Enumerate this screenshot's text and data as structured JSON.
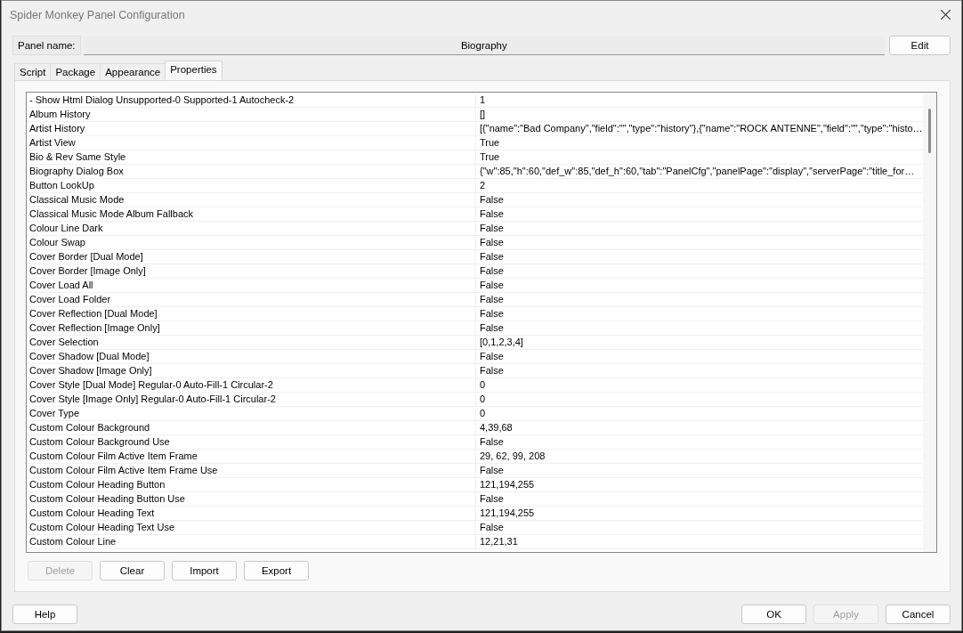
{
  "window": {
    "title": "Spider Monkey Panel Configuration"
  },
  "panel_name": {
    "label": "Panel name:",
    "value": "Biography",
    "button": "Edit"
  },
  "tabs": [
    {
      "label": "Script",
      "selected": false
    },
    {
      "label": "Package",
      "selected": false
    },
    {
      "label": "Appearance",
      "selected": false
    },
    {
      "label": "Properties",
      "selected": true
    }
  ],
  "properties": [
    {
      "name": "- Show Html Dialog Unsupported-0 Supported-1 Autocheck-2",
      "value": "1"
    },
    {
      "name": "Album History",
      "value": "[]"
    },
    {
      "name": "Artist History",
      "value": "[{\"name\":\"Bad Company\",\"field\":\"\",\"type\":\"history\"},{\"name\":\"ROCK ANTENNE\",\"field\":\"\",\"type\":\"histo…"
    },
    {
      "name": "Artist View",
      "value": "True"
    },
    {
      "name": "Bio & Rev Same Style",
      "value": "True"
    },
    {
      "name": "Biography Dialog Box",
      "value": "{\"w\":85,\"h\":60,\"def_w\":85,\"def_h\":60,\"tab\":\"PanelCfg\",\"panelPage\":\"display\",\"serverPage\":\"title_for…"
    },
    {
      "name": "Button LookUp",
      "value": "2"
    },
    {
      "name": "Classical Music Mode",
      "value": "False"
    },
    {
      "name": "Classical Music Mode Album Fallback",
      "value": "False"
    },
    {
      "name": "Colour Line Dark",
      "value": "False"
    },
    {
      "name": "Colour Swap",
      "value": "False"
    },
    {
      "name": "Cover Border [Dual Mode]",
      "value": "False"
    },
    {
      "name": "Cover Border [Image Only]",
      "value": "False"
    },
    {
      "name": "Cover Load All",
      "value": "False"
    },
    {
      "name": "Cover Load Folder",
      "value": "False"
    },
    {
      "name": "Cover Reflection [Dual Mode]",
      "value": "False"
    },
    {
      "name": "Cover Reflection [Image Only]",
      "value": "False"
    },
    {
      "name": "Cover Selection",
      "value": "[0,1,2,3,4]"
    },
    {
      "name": "Cover Shadow [Dual Mode]",
      "value": "False"
    },
    {
      "name": "Cover Shadow [Image Only]",
      "value": "False"
    },
    {
      "name": "Cover Style [Dual Mode] Regular-0 Auto-Fill-1 Circular-2",
      "value": "0"
    },
    {
      "name": "Cover Style [Image Only] Regular-0 Auto-Fill-1 Circular-2",
      "value": "0"
    },
    {
      "name": "Cover Type",
      "value": "0"
    },
    {
      "name": "Custom Colour Background",
      "value": "4,39,68"
    },
    {
      "name": "Custom Colour Background Use",
      "value": "False"
    },
    {
      "name": "Custom Colour Film Active Item Frame",
      "value": "29, 62, 99, 208"
    },
    {
      "name": "Custom Colour Film Active Item Frame Use",
      "value": "False"
    },
    {
      "name": "Custom Colour Heading Button",
      "value": "121,194,255"
    },
    {
      "name": "Custom Colour Heading Button Use",
      "value": "False"
    },
    {
      "name": "Custom Colour Heading Text",
      "value": "121,194,255"
    },
    {
      "name": "Custom Colour Heading Text Use",
      "value": "False"
    },
    {
      "name": "Custom Colour Line",
      "value": "12,21,31"
    }
  ],
  "property_buttons": [
    {
      "label": "Delete",
      "disabled": true
    },
    {
      "label": "Clear",
      "disabled": false
    },
    {
      "label": "Import",
      "disabled": false
    },
    {
      "label": "Export",
      "disabled": false
    }
  ],
  "footer_left": [
    {
      "label": "Help",
      "disabled": false
    }
  ],
  "footer_right": [
    {
      "label": "OK",
      "disabled": false
    },
    {
      "label": "Apply",
      "disabled": true
    },
    {
      "label": "Cancel",
      "disabled": false
    }
  ]
}
